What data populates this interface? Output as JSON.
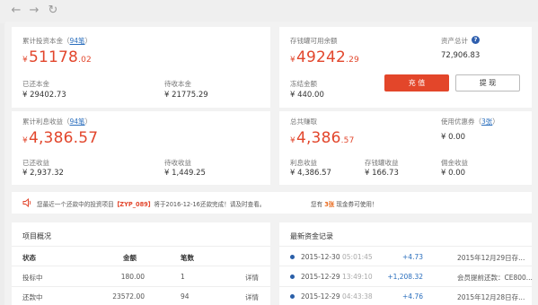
{
  "browser": {
    "back_icon": "arrow-left-icon",
    "forward_icon": "arrow-right-icon",
    "refresh_icon": "refresh-icon"
  },
  "colors": {
    "accent_red": "#e2462c",
    "link_blue": "#2a6ebd",
    "orange": "#e86a1d"
  },
  "invest_principal": {
    "label": "累计投资本金",
    "count_paren_open": "（",
    "count_link": "94笔",
    "count_paren_close": "）",
    "currency": "¥",
    "amount_int": "51178",
    "amount_dec": ".02",
    "repaid_label": "已还本金",
    "repaid_value": "¥ 29402.73",
    "pending_label": "待收本金",
    "pending_value": "¥ 21775.29"
  },
  "wallet": {
    "balance_label": "存钱罐可用余额",
    "currency": "¥",
    "balance_int": "49242",
    "balance_dec": ".29",
    "frozen_label": "冻结金额",
    "frozen_value": "¥ 440.00",
    "total_assets_label": "资产总计",
    "total_assets_value": "72,906.83",
    "recharge_button": "充 值",
    "withdraw_button": "提 现"
  },
  "income": {
    "label": "累计利息收益",
    "count_paren_open": "（",
    "count_link": "94笔",
    "count_paren_close": "）",
    "currency": "¥",
    "amount_int": "4,386.57",
    "earned_label": "已还收益",
    "earned_value": "¥ 2,937.32",
    "pending_label": "待收收益",
    "pending_value": "¥ 1,449.25"
  },
  "earnings": {
    "label": "总共赚取",
    "currency": "¥",
    "amount_int": "4,386",
    "amount_dec": ".57",
    "coupon_label": "使用优惠券",
    "coupon_paren_open": "（",
    "coupon_link": "3张",
    "coupon_paren_close": "）",
    "coupon_value": "¥ 0.00",
    "interest_label": "利息收益",
    "interest_value": "¥ 4,386.57",
    "wallet_income_label": "存钱罐收益",
    "wallet_income_value": "¥ 166.73",
    "commission_label": "佣金收益",
    "commission_value": "¥ 0.00"
  },
  "notice": {
    "speaker_icon": "speaker-icon",
    "text_before": "您最近一个还款中的投资项目",
    "project": "【ZYP_089】",
    "text_after": "将于2016-12-16还款完成！请及时查看。",
    "voucher_before": "您有",
    "voucher_count": "3张",
    "voucher_after": "现金券可使用！"
  },
  "overview": {
    "title": "项目概况",
    "headers": [
      "状态",
      "金额",
      "笔数"
    ],
    "rows": [
      {
        "status": "投标中",
        "amount": "180.00",
        "count": "1",
        "action": "详情"
      },
      {
        "status": "还款中",
        "amount": "23572.00",
        "count": "94",
        "action": "详情"
      }
    ]
  },
  "records": {
    "title": "最新资金记录",
    "items": [
      {
        "date": "2015-12-30",
        "time": "05:01:45",
        "amount": "+4.73",
        "desc": "2015年12月29日存..."
      },
      {
        "date": "2015-12-29",
        "time": "13:49:10",
        "amount": "+1,208.32",
        "desc": "会员提前还款：CE800..."
      },
      {
        "date": "2015-12-29",
        "time": "04:43:38",
        "amount": "+4.76",
        "desc": "2015年12月28日存..."
      }
    ]
  }
}
